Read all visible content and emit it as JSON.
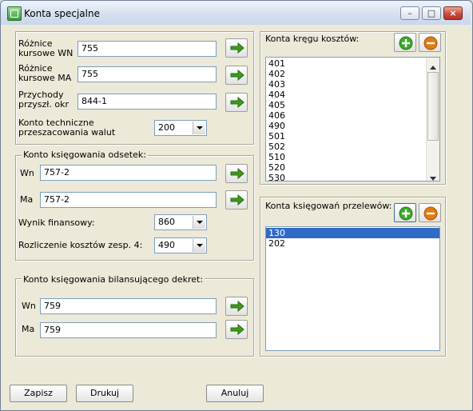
{
  "window": {
    "title": "Konta specjalne"
  },
  "left": {
    "rows": [
      {
        "label": "Różnice kursowe WN",
        "value": "755"
      },
      {
        "label": "Różnice kursowe MA",
        "value": "755"
      },
      {
        "label": "Przychody przyszł. okr",
        "value": "844-1"
      }
    ],
    "tech_label": "Konto techniczne przeszacowania walut",
    "tech_value": "200",
    "interest": {
      "title": "Konto księgowania odsetek:",
      "wn_label": "Wn",
      "wn_value": "757-2",
      "ma_label": "Ma",
      "ma_value": "757-2",
      "result_label": "Wynik finansowy:",
      "result_value": "860",
      "costs_label": "Rozliczenie kosztów zesp. 4:",
      "costs_value": "490"
    },
    "balance": {
      "title": "Konto księgowania bilansującego dekret:",
      "wn_label": "Wn",
      "wn_value": "759",
      "ma_label": "Ma",
      "ma_value": "759"
    }
  },
  "cost_accounts": {
    "title": "Konta kręgu kosztów:",
    "items": [
      "401",
      "402",
      "403",
      "404",
      "405",
      "406",
      "490",
      "501",
      "502",
      "510",
      "520",
      "530"
    ]
  },
  "transfer_accounts": {
    "title": "Konta księgowań przelewów:",
    "items": [
      "130",
      "202"
    ],
    "selected": "130"
  },
  "buttons": {
    "save": "Zapisz",
    "print": "Drukuj",
    "cancel": "Anuluj"
  },
  "colors": {
    "arrow_green": "#3d9a1b",
    "plus_green": "#3cab2a",
    "minus_orange": "#e07b12",
    "selection": "#316ac5"
  }
}
